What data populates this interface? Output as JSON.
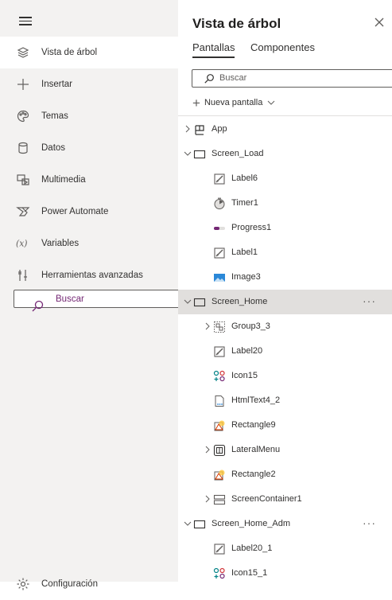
{
  "left_nav": {
    "items": [
      {
        "label": "Vista de árbol",
        "icon": "layers-icon"
      },
      {
        "label": "Insertar",
        "icon": "plus-icon"
      },
      {
        "label": "Temas",
        "icon": "palette-icon"
      },
      {
        "label": "Datos",
        "icon": "database-icon"
      },
      {
        "label": "Multimedia",
        "icon": "media-icon"
      },
      {
        "label": "Power Automate",
        "icon": "power-automate-icon"
      },
      {
        "label": "Variables",
        "icon": "variables-icon"
      },
      {
        "label": "Herramientas avanzadas",
        "icon": "advanced-tools-icon"
      },
      {
        "label": "Buscar",
        "icon": "search-icon"
      },
      {
        "label": "Configuración",
        "icon": "gear-icon"
      }
    ]
  },
  "panel": {
    "title": "Vista de árbol",
    "tabs": [
      "Pantallas",
      "Componentes"
    ],
    "search_placeholder": "Buscar",
    "new_screen_label": "Nueva pantalla"
  },
  "tree": [
    {
      "label": "App",
      "level": 0,
      "icon": "app-icon",
      "chevron": "right"
    },
    {
      "label": "Screen_Load",
      "level": 0,
      "icon": "screen-icon",
      "chevron": "down"
    },
    {
      "label": "Label6",
      "level": 1,
      "icon": "label-icon"
    },
    {
      "label": "Timer1",
      "level": 1,
      "icon": "timer-icon"
    },
    {
      "label": "Progress1",
      "level": 1,
      "icon": "progress-icon"
    },
    {
      "label": "Label1",
      "level": 1,
      "icon": "label-icon"
    },
    {
      "label": "Image3",
      "level": 1,
      "icon": "image-icon"
    },
    {
      "label": "Screen_Home",
      "level": 0,
      "icon": "screen-icon",
      "chevron": "down",
      "highlighted": true,
      "more": "···"
    },
    {
      "label": "Group3_3",
      "level": 1,
      "icon": "group-icon",
      "chevron": "right"
    },
    {
      "label": "Label20",
      "level": 1,
      "icon": "label-icon"
    },
    {
      "label": "Icon15",
      "level": 1,
      "icon": "icon-control-icon"
    },
    {
      "label": "HtmlText4_2",
      "level": 1,
      "icon": "html-text-icon"
    },
    {
      "label": "Rectangle9",
      "level": 1,
      "icon": "shape-icon"
    },
    {
      "label": "LateralMenu",
      "level": 1,
      "icon": "component-icon",
      "chevron": "right"
    },
    {
      "label": "Rectangle2",
      "level": 1,
      "icon": "shape-icon"
    },
    {
      "label": "ScreenContainer1",
      "level": 1,
      "icon": "container-icon",
      "chevron": "right"
    },
    {
      "label": "Screen_Home_Adm",
      "level": 0,
      "icon": "screen-icon",
      "chevron": "down",
      "more": "···"
    },
    {
      "label": "Label20_1",
      "level": 1,
      "icon": "label-icon"
    },
    {
      "label": "Icon15_1",
      "level": 1,
      "icon": "icon-control-icon"
    }
  ]
}
